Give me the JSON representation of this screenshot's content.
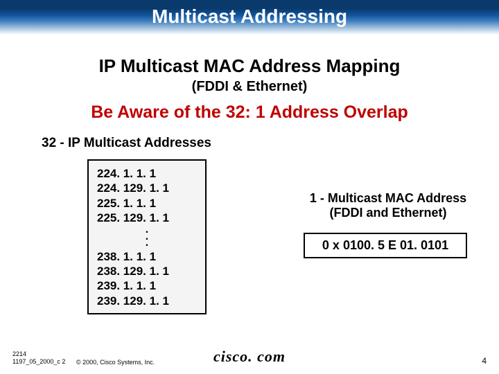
{
  "title": "Multicast Addressing",
  "subtitle1": "IP Multicast MAC Address Mapping",
  "subtitle2": "(FDDI & Ethernet)",
  "warning": "Be Aware of the 32: 1 Address Overlap",
  "section_label": "32 - IP Multicast Addresses",
  "ip_addresses_top": "224. 1. 1. 1\n224. 129. 1. 1\n225. 1. 1. 1\n225. 129. 1. 1",
  "dots": ".\n.\n.",
  "ip_addresses_bottom": "238. 1. 1. 1\n238. 129. 1. 1\n239. 1. 1. 1\n239. 129. 1. 1",
  "mac_label": "1 - Multicast MAC Address\n(FDDI and Ethernet)",
  "mac_value": "0 x 0100. 5 E 01. 0101",
  "footer": {
    "code1": "2214",
    "code2": "1197_05_2000_c 2",
    "copyright": "© 2000, Cisco Systems, Inc.",
    "brand": "cisco. com",
    "page": "4"
  }
}
